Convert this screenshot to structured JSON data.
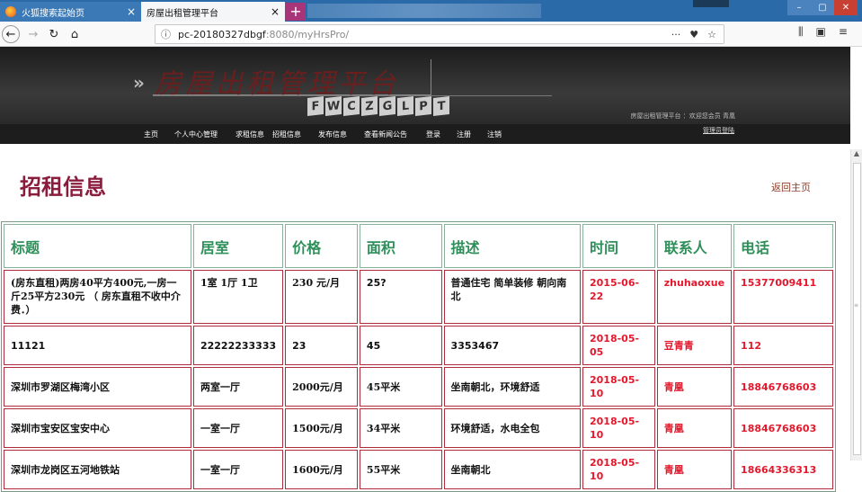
{
  "browser": {
    "tabs": [
      {
        "label": "火狐搜索起始页",
        "close": "×"
      },
      {
        "label": "房屋出租管理平台",
        "close": "×"
      }
    ],
    "newtab": "+",
    "url_host": "pc-20180327dbgf",
    "url_rest": ":8080/myHrsPro/",
    "url_actions": {
      "more": "···",
      "pocket": "♥",
      "star": "☆"
    },
    "toolbar_icons": {
      "library": "⫼",
      "sidebar": "▣",
      "menu": "≡"
    },
    "window_controls": {
      "min": "–",
      "max": "▢",
      "close": "✕"
    }
  },
  "site": {
    "banner_title": "房屋出租管理平台",
    "logo_letters": [
      "F",
      "W",
      "C",
      "Z",
      "G",
      "L",
      "P",
      "T"
    ],
    "welcome": "房屋出租管理平台 ：欢迎您会员 青凰",
    "menu": [
      "主页",
      "个人中心管理",
      "求租信息",
      "招租信息",
      "发布信息",
      "查看新闻公告",
      "登录",
      "注册",
      "注销"
    ],
    "admin_link": "管理员登陆"
  },
  "content": {
    "heading": "招租信息",
    "back_link": "返回主页",
    "columns": [
      "标题",
      "居室",
      "价格",
      "面积",
      "描述",
      "时间",
      "联系人",
      "电话"
    ],
    "rows": [
      [
        "(房东直租)两房40平方400元,一房一斤25平方230元 （ 房东直租不收中介费．）",
        "1室 1厅 1卫",
        "230 元/月",
        "25?",
        "普通住宅 简单装修 朝向南北",
        "2015-06-22",
        "zhuhaoxue",
        "15377009411"
      ],
      [
        "11121",
        "22222233333",
        "23",
        "45",
        "3353467",
        "2018-05-05",
        "豆青青",
        "112"
      ],
      [
        "深圳市罗湖区梅湾小区",
        "两室一厅",
        "2000元/月",
        "45平米",
        "坐南朝北，环境舒适",
        "2018-05-10",
        "青凰",
        "18846768603"
      ],
      [
        "深圳市宝安区宝安中心",
        "一室一厅",
        "1500元/月",
        "34平米",
        "环境舒适，水电全包",
        "2018-05-10",
        "青凰",
        "18846768603"
      ],
      [
        "深圳市龙岗区五河地铁站",
        "一室一厅",
        "1600元/月",
        "55平米",
        "坐南朝北",
        "2018-05-10",
        "青凰",
        "18664336313"
      ]
    ]
  },
  "colors": {
    "heading": "#8a1c3c",
    "header_text": "#2f8f5a",
    "red_text": "#e3182c"
  }
}
